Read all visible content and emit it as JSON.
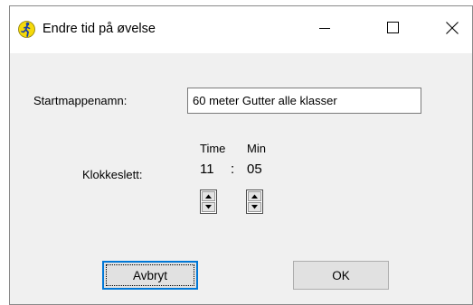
{
  "window": {
    "title": "Endre tid på øvelse",
    "icon": "running-person-icon"
  },
  "titlebar_buttons": {
    "minimize": "minimize-icon",
    "maximize": "maximize-icon",
    "close": "close-icon"
  },
  "form": {
    "startmappe_label": "Startmappenamn:",
    "startmappe_value": "60 meter Gutter alle klasser",
    "klokkeslett_label": "Klokkeslett:",
    "time_header": "Time",
    "min_header": "Min",
    "hour_value": "11",
    "separator": ":",
    "minute_value": "05"
  },
  "buttons": {
    "cancel_label": "Avbryt",
    "ok_label": "OK"
  },
  "colors": {
    "dialog_bg": "#f0f0f0",
    "titlebar_bg": "#ffffff",
    "accent": "#0078d7",
    "button_bg": "#e1e1e1"
  }
}
